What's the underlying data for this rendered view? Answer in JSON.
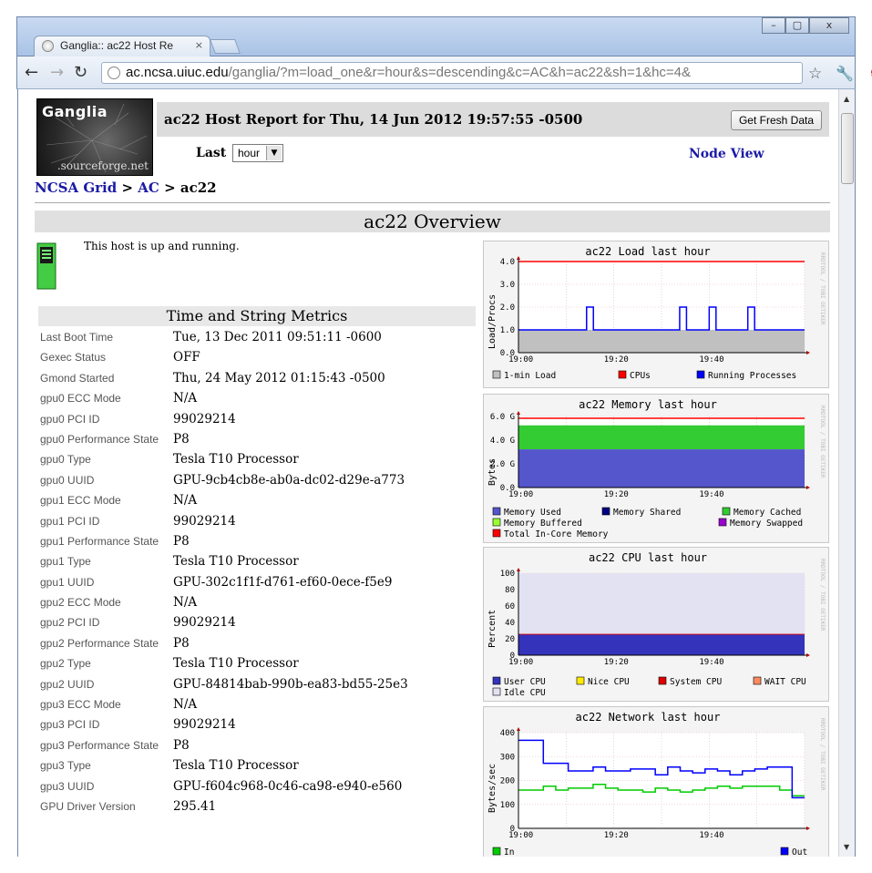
{
  "browser": {
    "tab_title": "Ganglia:: ac22 Host Re",
    "tab_close": "×",
    "url_host": "ac.ncsa.uiuc.edu",
    "url_rest": "/ganglia/?m=load_one&r=hour&s=descending&c=AC&h=ac22&sh=1&hc=4&",
    "window_buttons": [
      "–",
      "▢",
      "x"
    ]
  },
  "header": {
    "logo_title": "Ganglia",
    "logo_sub": ".sourceforge.net",
    "title": "ac22 Host Report for Thu, 14 Jun 2012 19:57:55 -0500",
    "fresh_button": "Get Fresh Data",
    "last_label": "Last",
    "range_value": "hour",
    "node_view": "Node View"
  },
  "breadcrumb": {
    "grid": "NCSA Grid",
    "sep1": " > ",
    "cluster": "AC",
    "sep2": " > ",
    "host": "ac22"
  },
  "overview_title": "ac22 Overview",
  "host_status": "This host is up and running.",
  "metrics_title": "Time and String Metrics",
  "metrics": [
    {
      "k": "Last Boot Time",
      "v": "Tue, 13 Dec 2011 09:51:11 -0600"
    },
    {
      "k": "Gexec Status",
      "v": "OFF"
    },
    {
      "k": "Gmond Started",
      "v": "Thu, 24 May 2012 01:15:43 -0500"
    },
    {
      "k": "gpu0 ECC Mode",
      "v": "N/A"
    },
    {
      "k": "gpu0 PCI ID",
      "v": "99029214"
    },
    {
      "k": "gpu0 Performance State",
      "v": "P8"
    },
    {
      "k": "gpu0 Type",
      "v": "Tesla T10 Processor"
    },
    {
      "k": "gpu0 UUID",
      "v": "GPU-9cb4cb8e-ab0a-dc02-d29e-a773"
    },
    {
      "k": "gpu1 ECC Mode",
      "v": "N/A"
    },
    {
      "k": "gpu1 PCI ID",
      "v": "99029214"
    },
    {
      "k": "gpu1 Performance State",
      "v": "P8"
    },
    {
      "k": "gpu1 Type",
      "v": "Tesla T10 Processor"
    },
    {
      "k": "gpu1 UUID",
      "v": "GPU-302c1f1f-d761-ef60-0ece-f5e9"
    },
    {
      "k": "gpu2 ECC Mode",
      "v": "N/A"
    },
    {
      "k": "gpu2 PCI ID",
      "v": "99029214"
    },
    {
      "k": "gpu2 Performance State",
      "v": "P8"
    },
    {
      "k": "gpu2 Type",
      "v": "Tesla T10 Processor"
    },
    {
      "k": "gpu2 UUID",
      "v": "GPU-84814bab-990b-ea83-bd55-25e3"
    },
    {
      "k": "gpu3 ECC Mode",
      "v": "N/A"
    },
    {
      "k": "gpu3 PCI ID",
      "v": "99029214"
    },
    {
      "k": "gpu3 Performance State",
      "v": "P8"
    },
    {
      "k": "gpu3 Type",
      "v": "Tesla T10 Processor"
    },
    {
      "k": "gpu3 UUID",
      "v": "GPU-f604c968-0c46-ca98-e940-e560"
    },
    {
      "k": "GPU Driver Version",
      "v": "295.41"
    }
  ],
  "chart_data": [
    {
      "type": "line",
      "title": "ac22 Load last hour",
      "ylabel": "Load/Procs",
      "ylim": [
        0,
        4.0
      ],
      "yticks": [
        "4.0",
        "3.0",
        "2.0",
        "1.0",
        "0.0"
      ],
      "xticks": [
        "19:00",
        "19:20",
        "19:40"
      ],
      "legend": [
        "1-min Load",
        "CPUs",
        "Running Processes"
      ],
      "colors": [
        "#c0c0c0",
        "#ff0000",
        "#0000ff"
      ],
      "cpus": 4,
      "running_processes": [
        {
          "t": 0,
          "v": 1
        },
        {
          "t": 15,
          "v": 1
        },
        {
          "t": 15,
          "v": 2
        },
        {
          "t": 16.5,
          "v": 2
        },
        {
          "t": 16.5,
          "v": 1
        },
        {
          "t": 35.5,
          "v": 1
        },
        {
          "t": 35.5,
          "v": 2
        },
        {
          "t": 37,
          "v": 2
        },
        {
          "t": 37,
          "v": 1
        },
        {
          "t": 42,
          "v": 1
        },
        {
          "t": 42,
          "v": 2
        },
        {
          "t": 43.5,
          "v": 2
        },
        {
          "t": 43.5,
          "v": 1
        },
        {
          "t": 50.5,
          "v": 1
        },
        {
          "t": 50.5,
          "v": 2
        },
        {
          "t": 52,
          "v": 2
        },
        {
          "t": 52,
          "v": 1
        },
        {
          "t": 63,
          "v": 1
        }
      ],
      "load_one": 1.0
    },
    {
      "type": "area",
      "title": "ac22 Memory last hour",
      "ylabel": "Bytes",
      "yticks": [
        "6.0 G",
        "4.0 G",
        "2.0 G",
        "0.0"
      ],
      "xticks": [
        "19:00",
        "19:20",
        "19:40"
      ],
      "legend": [
        "Memory Used",
        "Memory Shared",
        "Memory Cached",
        "Memory Buffered",
        "Memory Swapped",
        "Total In-Core Memory"
      ],
      "colors": [
        "#5555cc",
        "#000080",
        "#33cc33",
        "#99ff33",
        "#9900cc",
        "#ff0000"
      ],
      "memory_used_gb": 4.3,
      "memory_cached_top_gb": 7.0,
      "total_gb": 7.8
    },
    {
      "type": "area",
      "title": "ac22 CPU last hour",
      "ylabel": "Percent",
      "yticks": [
        "100",
        "80",
        "60",
        "40",
        "20",
        "0"
      ],
      "xticks": [
        "19:00",
        "19:20",
        "19:40"
      ],
      "legend": [
        "User CPU",
        "Nice CPU",
        "System CPU",
        "WAIT CPU",
        "Idle CPU"
      ],
      "colors": [
        "#3333bb",
        "#ffea00",
        "#dd0000",
        "#ff8a60",
        "#e2e2f2"
      ],
      "user_cpu": 25,
      "system_cpu": 1
    },
    {
      "type": "line",
      "title": "ac22 Network last hour",
      "ylabel": "Bytes/sec",
      "yticks": [
        "400",
        "300",
        "200",
        "100",
        "0"
      ],
      "xticks": [
        "19:00",
        "19:20",
        "19:40"
      ],
      "legend": [
        "In",
        "Out"
      ],
      "colors": [
        "#00cc00",
        "#0000ff"
      ],
      "out": [
        460,
        460,
        340,
        340,
        300,
        300,
        320,
        300,
        300,
        310,
        310,
        280,
        320,
        300,
        290,
        310,
        300,
        280,
        300,
        310,
        320,
        320,
        160
      ],
      "in": [
        200,
        200,
        220,
        200,
        210,
        210,
        230,
        210,
        200,
        200,
        190,
        210,
        200,
        190,
        200,
        210,
        220,
        210,
        220,
        220,
        220,
        200,
        170
      ]
    }
  ]
}
